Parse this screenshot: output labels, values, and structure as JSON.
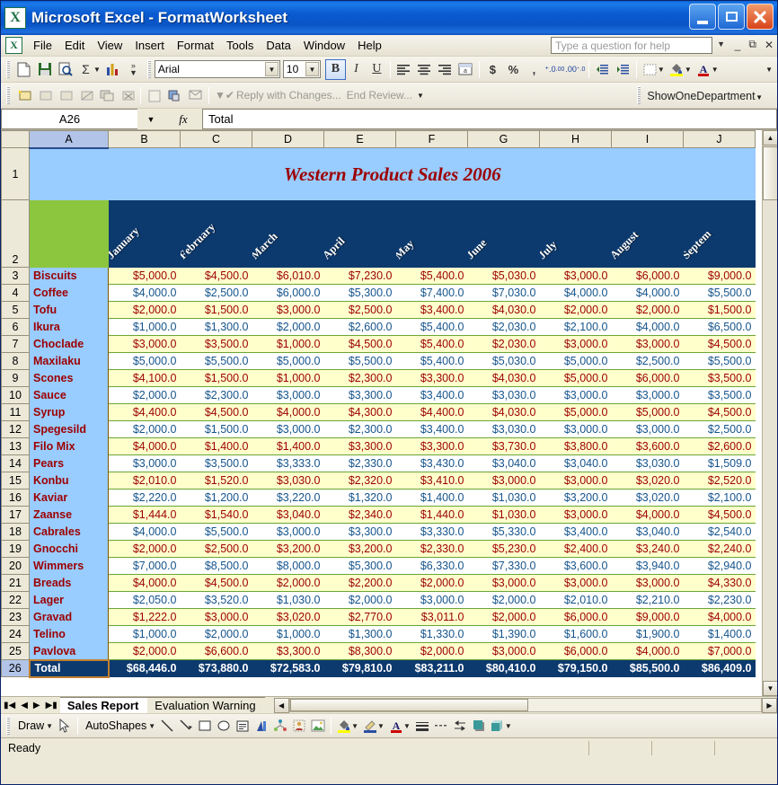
{
  "window": {
    "title": "Microsoft Excel - FormatWorksheet",
    "app_icon": "excel-icon",
    "minimize": "minimize-icon",
    "maximize": "maximize-icon",
    "close": "close-icon"
  },
  "menu": {
    "items": [
      "File",
      "Edit",
      "View",
      "Insert",
      "Format",
      "Tools",
      "Data",
      "Window",
      "Help"
    ],
    "ask_placeholder": "Type a question for help"
  },
  "toolbar": {
    "font_name": "Arial",
    "font_size": "10",
    "bold": "B",
    "italic": "I",
    "underline": "U",
    "currency": "$",
    "percent": "%",
    "comma": ",",
    "macro_name": "ShowOneDepartment",
    "reviewing": {
      "reply_with_changes": "Reply with Changes...",
      "end_review": "End Review..."
    }
  },
  "formula_bar": {
    "name_box": "A26",
    "fx": "fx",
    "value": "Total"
  },
  "grid": {
    "columns": [
      "A",
      "B",
      "C",
      "D",
      "E",
      "F",
      "G",
      "H",
      "I",
      "J"
    ],
    "selected_column": "A",
    "selected_row": "26",
    "row_numbers": [
      "1",
      "2",
      "3",
      "4",
      "5",
      "6",
      "7",
      "8",
      "9",
      "10",
      "11",
      "12",
      "13",
      "14",
      "15",
      "16",
      "17",
      "18",
      "19",
      "20",
      "21",
      "22",
      "23",
      "24",
      "25",
      "26"
    ],
    "title": "Western Product Sales 2006",
    "month_headers": [
      "January",
      "February",
      "March",
      "April",
      "May",
      "June",
      "July",
      "August",
      "Septem"
    ],
    "total_label": "Total"
  },
  "chart_data": {
    "type": "table",
    "title": "Western Product Sales 2006",
    "categories": [
      "January",
      "February",
      "March",
      "April",
      "May",
      "June",
      "July",
      "August",
      "September"
    ],
    "rows": [
      {
        "name": "Biscuits",
        "values": [
          "$5,000.0",
          "$4,500.0",
          "$6,010.0",
          "$7,230.0",
          "$5,400.0",
          "$5,030.0",
          "$3,000.0",
          "$6,000.0",
          "$9,000.0"
        ]
      },
      {
        "name": "Coffee",
        "values": [
          "$4,000.0",
          "$2,500.0",
          "$6,000.0",
          "$5,300.0",
          "$7,400.0",
          "$7,030.0",
          "$4,000.0",
          "$4,000.0",
          "$5,500.0"
        ]
      },
      {
        "name": "Tofu",
        "values": [
          "$2,000.0",
          "$1,500.0",
          "$3,000.0",
          "$2,500.0",
          "$3,400.0",
          "$4,030.0",
          "$2,000.0",
          "$2,000.0",
          "$1,500.0"
        ]
      },
      {
        "name": "Ikura",
        "values": [
          "$1,000.0",
          "$1,300.0",
          "$2,000.0",
          "$2,600.0",
          "$5,400.0",
          "$2,030.0",
          "$2,100.0",
          "$4,000.0",
          "$6,500.0"
        ]
      },
      {
        "name": "Choclade",
        "values": [
          "$3,000.0",
          "$3,500.0",
          "$1,000.0",
          "$4,500.0",
          "$5,400.0",
          "$2,030.0",
          "$3,000.0",
          "$3,000.0",
          "$4,500.0"
        ]
      },
      {
        "name": "Maxilaku",
        "values": [
          "$5,000.0",
          "$5,500.0",
          "$5,000.0",
          "$5,500.0",
          "$5,400.0",
          "$5,030.0",
          "$5,000.0",
          "$2,500.0",
          "$5,500.0"
        ]
      },
      {
        "name": "Scones",
        "values": [
          "$4,100.0",
          "$1,500.0",
          "$1,000.0",
          "$2,300.0",
          "$3,300.0",
          "$4,030.0",
          "$5,000.0",
          "$6,000.0",
          "$3,500.0"
        ]
      },
      {
        "name": "Sauce",
        "values": [
          "$2,000.0",
          "$2,300.0",
          "$3,000.0",
          "$3,300.0",
          "$3,400.0",
          "$3,030.0",
          "$3,000.0",
          "$3,000.0",
          "$3,500.0"
        ]
      },
      {
        "name": "Syrup",
        "values": [
          "$4,400.0",
          "$4,500.0",
          "$4,000.0",
          "$4,300.0",
          "$4,400.0",
          "$4,030.0",
          "$5,000.0",
          "$5,000.0",
          "$4,500.0"
        ]
      },
      {
        "name": "Spegesild",
        "values": [
          "$2,000.0",
          "$1,500.0",
          "$3,000.0",
          "$2,300.0",
          "$3,400.0",
          "$3,030.0",
          "$3,000.0",
          "$3,000.0",
          "$2,500.0"
        ]
      },
      {
        "name": "Filo Mix",
        "values": [
          "$4,000.0",
          "$1,400.0",
          "$1,400.0",
          "$3,300.0",
          "$3,300.0",
          "$3,730.0",
          "$3,800.0",
          "$3,600.0",
          "$2,600.0"
        ]
      },
      {
        "name": "Pears",
        "values": [
          "$3,000.0",
          "$3,500.0",
          "$3,333.0",
          "$2,330.0",
          "$3,430.0",
          "$3,040.0",
          "$3,040.0",
          "$3,030.0",
          "$1,509.0"
        ]
      },
      {
        "name": "Konbu",
        "values": [
          "$2,010.0",
          "$1,520.0",
          "$3,030.0",
          "$2,320.0",
          "$3,410.0",
          "$3,000.0",
          "$3,000.0",
          "$3,020.0",
          "$2,520.0"
        ]
      },
      {
        "name": "Kaviar",
        "values": [
          "$2,220.0",
          "$1,200.0",
          "$3,220.0",
          "$1,320.0",
          "$1,400.0",
          "$1,030.0",
          "$3,200.0",
          "$3,020.0",
          "$2,100.0"
        ]
      },
      {
        "name": "Zaanse",
        "values": [
          "$1,444.0",
          "$1,540.0",
          "$3,040.0",
          "$2,340.0",
          "$1,440.0",
          "$1,030.0",
          "$3,000.0",
          "$4,000.0",
          "$4,500.0"
        ]
      },
      {
        "name": "Cabrales",
        "values": [
          "$4,000.0",
          "$5,500.0",
          "$3,000.0",
          "$3,300.0",
          "$3,330.0",
          "$5,330.0",
          "$3,400.0",
          "$3,040.0",
          "$2,540.0"
        ]
      },
      {
        "name": "Gnocchi",
        "values": [
          "$2,000.0",
          "$2,500.0",
          "$3,200.0",
          "$3,200.0",
          "$2,330.0",
          "$5,230.0",
          "$2,400.0",
          "$3,240.0",
          "$2,240.0"
        ]
      },
      {
        "name": "Wimmers",
        "values": [
          "$7,000.0",
          "$8,500.0",
          "$8,000.0",
          "$5,300.0",
          "$6,330.0",
          "$7,330.0",
          "$3,600.0",
          "$3,940.0",
          "$2,940.0"
        ]
      },
      {
        "name": "Breads",
        "values": [
          "$4,000.0",
          "$4,500.0",
          "$2,000.0",
          "$2,200.0",
          "$2,000.0",
          "$3,000.0",
          "$3,000.0",
          "$3,000.0",
          "$4,330.0"
        ]
      },
      {
        "name": "Lager",
        "values": [
          "$2,050.0",
          "$3,520.0",
          "$1,030.0",
          "$2,000.0",
          "$3,000.0",
          "$2,000.0",
          "$2,010.0",
          "$2,210.0",
          "$2,230.0"
        ]
      },
      {
        "name": "Gravad",
        "values": [
          "$1,222.0",
          "$3,000.0",
          "$3,020.0",
          "$2,770.0",
          "$3,011.0",
          "$2,000.0",
          "$6,000.0",
          "$9,000.0",
          "$4,000.0"
        ]
      },
      {
        "name": "Telino",
        "values": [
          "$1,000.0",
          "$2,000.0",
          "$1,000.0",
          "$1,300.0",
          "$1,330.0",
          "$1,390.0",
          "$1,600.0",
          "$1,900.0",
          "$1,400.0"
        ]
      },
      {
        "name": "Pavlova",
        "values": [
          "$2,000.0",
          "$6,600.0",
          "$3,300.0",
          "$8,300.0",
          "$2,000.0",
          "$3,000.0",
          "$6,000.0",
          "$4,000.0",
          "$7,000.0"
        ]
      }
    ],
    "total": {
      "name": "Total",
      "values": [
        "$68,446.0",
        "$73,880.0",
        "$72,583.0",
        "$79,810.0",
        "$83,211.0",
        "$80,410.0",
        "$79,150.0",
        "$85,500.0",
        "$86,409.0"
      ]
    }
  },
  "sheet_tabs": {
    "active": "Sales Report",
    "inactive": [
      "Evaluation Warning"
    ]
  },
  "drawing_toolbar": {
    "draw_label": "Draw",
    "autoshapes_label": "AutoShapes"
  },
  "status_bar": {
    "text": "Ready"
  },
  "colors": {
    "title_bar": "#0a55c6",
    "header_navy": "#0d3a6e",
    "header_green": "#8cc63e",
    "title_row_blue": "#99ccff",
    "odd_row": "#ffffcc",
    "odd_text": "#9c0000",
    "even_text": "#16548c",
    "name_col": "#99ccff"
  }
}
